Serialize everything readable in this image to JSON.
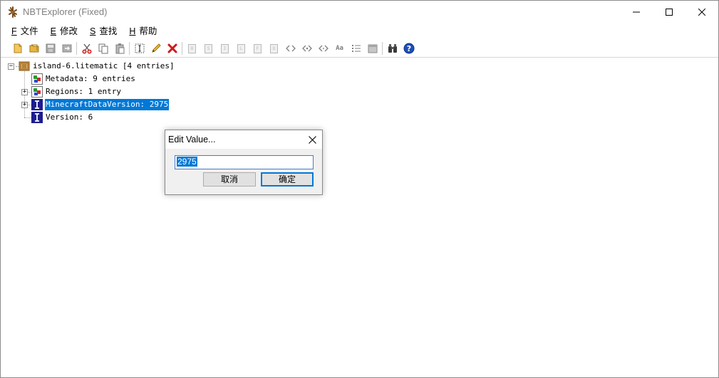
{
  "window": {
    "title": "NBTExplorer (Fixed)"
  },
  "menu": [
    {
      "key": "F",
      "label": "文件"
    },
    {
      "key": "E",
      "label": "修改"
    },
    {
      "key": "S",
      "label": "查找"
    },
    {
      "key": "H",
      "label": "帮助"
    }
  ],
  "toolbar": {
    "icons": [
      "open-file-icon",
      "open-folder-icon",
      "save-icon",
      "refresh-icon",
      "cut-icon",
      "copy-icon",
      "paste-icon",
      "rename-icon",
      "edit-icon",
      "delete-icon",
      "add-byte-icon",
      "add-short-icon",
      "add-int-icon",
      "add-long-icon",
      "add-float-icon",
      "add-double-icon",
      "add-byte-array-icon",
      "add-int-array-icon",
      "add-long-array-icon",
      "add-string-icon",
      "add-list-icon",
      "add-compound-icon",
      "find-icon",
      "help-icon"
    ],
    "disabled_letters": [
      "B",
      "S",
      "I",
      "L",
      "F",
      "D"
    ],
    "string_tag": "Aa"
  },
  "tree": {
    "root": "island-6.litematic [4 entries]",
    "children": [
      {
        "label": "Metadata: 9 entries",
        "type": "compound",
        "expandable": true
      },
      {
        "label": "Regions: 1 entry",
        "type": "compound",
        "expandable": true
      },
      {
        "label": "MinecraftDataVersion: 2975",
        "type": "int",
        "selected": true
      },
      {
        "label": "Version: 6",
        "type": "int"
      }
    ]
  },
  "dialog": {
    "title": "Edit Value...",
    "value": "2975",
    "cancel_label": "取消",
    "ok_label": "确定"
  }
}
